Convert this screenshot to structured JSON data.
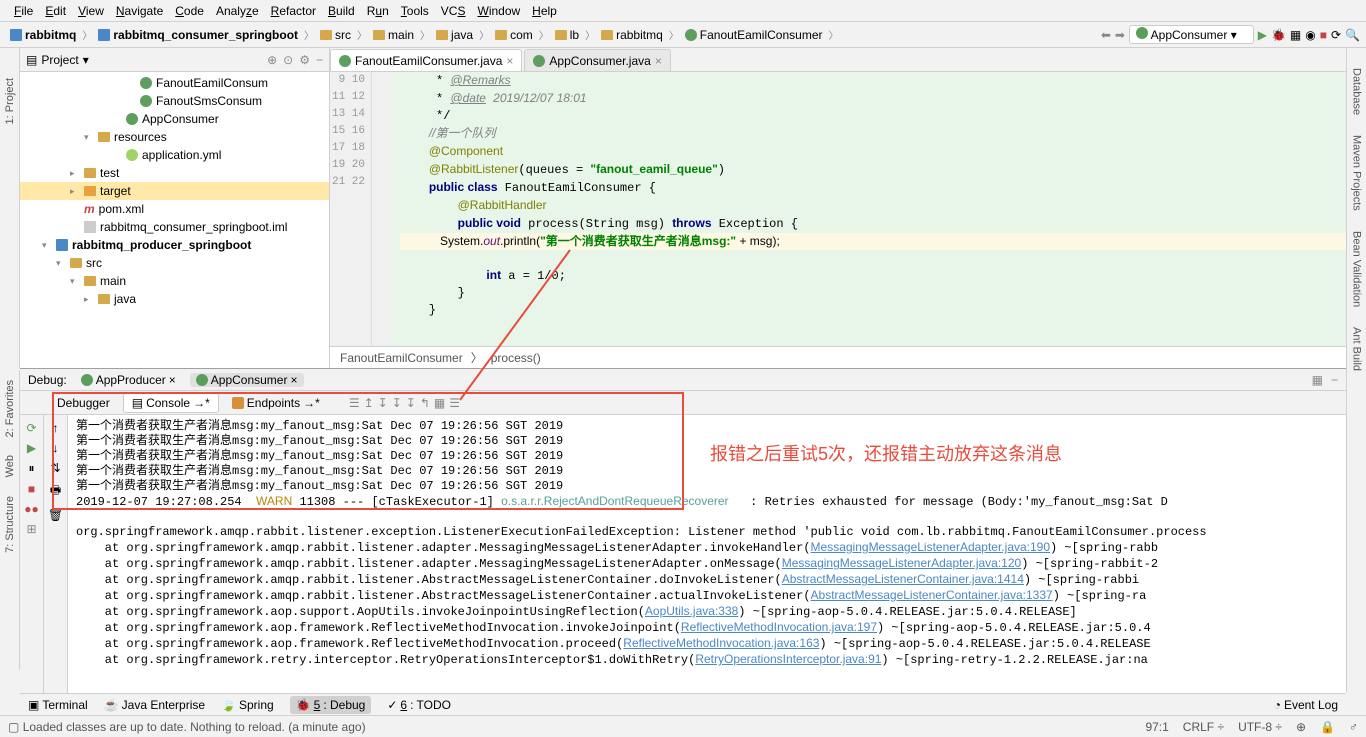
{
  "menubar": [
    "File",
    "Edit",
    "View",
    "Navigate",
    "Code",
    "Analyze",
    "Refactor",
    "Build",
    "Run",
    "Tools",
    "VCS",
    "Window",
    "Help"
  ],
  "breadcrumbs": [
    "rabbitmq",
    "rabbitmq_consumer_springboot",
    "src",
    "main",
    "java",
    "com",
    "lb",
    "rabbitmq",
    "FanoutEamilConsumer"
  ],
  "runConfig": "AppConsumer",
  "project": {
    "title": "Project",
    "tree": [
      {
        "indent": 7,
        "icon": "class",
        "name": "FanoutEamilConsum"
      },
      {
        "indent": 7,
        "icon": "class",
        "name": "FanoutSmsConsum"
      },
      {
        "indent": 6,
        "icon": "class-green",
        "name": "AppConsumer"
      },
      {
        "indent": 4,
        "arrow": "▾",
        "icon": "folder-res",
        "name": "resources"
      },
      {
        "indent": 6,
        "icon": "yml",
        "name": "application.yml"
      },
      {
        "indent": 3,
        "arrow": "▸",
        "icon": "folder",
        "name": "test"
      },
      {
        "indent": 3,
        "arrow": "▸",
        "icon": "folder-orange",
        "name": "target",
        "selected": true
      },
      {
        "indent": 3,
        "icon": "maven",
        "name": "pom.xml"
      },
      {
        "indent": 3,
        "icon": "file",
        "name": "rabbitmq_consumer_springboot.iml"
      },
      {
        "indent": 1,
        "arrow": "▾",
        "icon": "module",
        "name": "rabbitmq_producer_springboot",
        "bold": true
      },
      {
        "indent": 2,
        "arrow": "▾",
        "icon": "folder",
        "name": "src"
      },
      {
        "indent": 3,
        "arrow": "▾",
        "icon": "folder",
        "name": "main"
      },
      {
        "indent": 4,
        "arrow": "▸",
        "icon": "folder",
        "name": "java"
      }
    ]
  },
  "editorTabs": [
    {
      "name": "FanoutEamilConsumer.java",
      "active": true
    },
    {
      "name": "AppConsumer.java",
      "active": false
    }
  ],
  "code": {
    "startLine": 9,
    "lines": [
      {
        "n": 9,
        "html": "     * <span class='doctag'>@Remarks</span>"
      },
      {
        "n": 10,
        "html": "     * <span class='doctag'>@date</span> <span class='doc'>2019/12/07 18:01</span>"
      },
      {
        "n": 11,
        "html": "     */"
      },
      {
        "n": 12,
        "html": "    <span class='comment'>//第一个队列</span>"
      },
      {
        "n": 13,
        "html": "    <span class='anno'>@Component</span>"
      },
      {
        "n": 14,
        "html": "    <span class='anno'>@RabbitListener</span>(queues = <span class='str'>\"fanout_eamil_queue\"</span>)"
      },
      {
        "n": 15,
        "html": "    <span class='kw'>public class</span> FanoutEamilConsumer {"
      },
      {
        "n": 16,
        "html": "        <span class='anno'>@RabbitHandler</span>"
      },
      {
        "n": 17,
        "html": "        <span class='kw'>public void</span> process(String msg) <span class='kw'>throws</span> Exception {"
      },
      {
        "n": 18,
        "hl": true,
        "html": "            System.<span class='field'>out</span>.println(<span class='str'>\"第一个消费者获取生产者消息msg:\"</span> + msg);"
      },
      {
        "n": 19,
        "html": "            <span class='kw'>int</span> a = 1/0;"
      },
      {
        "n": 20,
        "html": "        }"
      },
      {
        "n": 21,
        "html": "    }"
      },
      {
        "n": 22,
        "html": ""
      }
    ]
  },
  "editorCrumbs": [
    "FanoutEamilConsumer",
    "process()"
  ],
  "debug": {
    "label": "Debug:",
    "tabs": [
      {
        "name": "AppProducer"
      },
      {
        "name": "AppConsumer",
        "active": true
      }
    ],
    "subtabs": [
      "Debugger",
      "Console",
      "Endpoints"
    ],
    "activeSubtab": "Console"
  },
  "console": {
    "repeated": "第一个消费者获取生产者消息msg:my_fanout_msg:Sat Dec 07 19:26:56 SGT 2019",
    "warnLine": {
      "ts": "2019-12-07 19:27:08.254",
      "level": "WARN",
      "pid": "11308",
      "thread": "[cTaskExecutor-1]",
      "logger": "o.s.a.r.r.RejectAndDontRequeueRecoverer",
      "msg": ": Retries exhausted for message (Body:'my_fanout_msg:Sat D"
    },
    "stack": [
      "org.springframework.amqp.rabbit.listener.exception.ListenerExecutionFailedException: Listener method 'public void com.lb.rabbitmq.FanoutEamilConsumer.process",
      "    at org.springframework.amqp.rabbit.listener.adapter.MessagingMessageListenerAdapter.invokeHandler(<link>MessagingMessageListenerAdapter.java:190</link>) ~[spring-rabb",
      "    at org.springframework.amqp.rabbit.listener.adapter.MessagingMessageListenerAdapter.onMessage(<link>MessagingMessageListenerAdapter.java:120</link>) ~[spring-rabbit-2",
      "    at org.springframework.amqp.rabbit.listener.AbstractMessageListenerContainer.doInvokeListener(<link>AbstractMessageListenerContainer.java:1414</link>) ~[spring-rabbi",
      "    at org.springframework.amqp.rabbit.listener.AbstractMessageListenerContainer.actualInvokeListener(<link>AbstractMessageListenerContainer.java:1337</link>) ~[spring-ra",
      "    at org.springframework.aop.support.AopUtils.invokeJoinpointUsingReflection(<link>AopUtils.java:338</link>) ~[spring-aop-5.0.4.RELEASE.jar:5.0.4.RELEASE]",
      "    at org.springframework.aop.framework.ReflectiveMethodInvocation.invokeJoinpoint(<link>ReflectiveMethodInvocation.java:197</link>) ~[spring-aop-5.0.4.RELEASE.jar:5.0.4",
      "    at org.springframework.aop.framework.ReflectiveMethodInvocation.proceed(<link>ReflectiveMethodInvocation.java:163</link>) ~[spring-aop-5.0.4.RELEASE.jar:5.0.4.RELEASE",
      "    at org.springframework.retry.interceptor.RetryOperationsInterceptor$1.doWithRetry(<link>RetryOperationsInterceptor.java:91</link>) ~[spring-retry-1.2.2.RELEASE.jar:na"
    ]
  },
  "annotation": "报错之后重试5次，还报错主动放弃这条消息",
  "bottomTools": [
    "Terminal",
    "Java Enterprise",
    "Spring",
    "5: Debug",
    "6: TODO"
  ],
  "bottomToolsActive": "5: Debug",
  "eventLog": "Event Log",
  "statusMessage": "Loaded classes are up to date. Nothing to reload. (a minute ago)",
  "statusRight": [
    "97:1",
    "CRLF ÷",
    "UTF-8 ÷",
    "⊕",
    "🔒",
    "♂"
  ],
  "leftStrip": [
    "1: Project"
  ],
  "leftStrip2": [
    "2: Favorites",
    "Web",
    "7: Structure"
  ],
  "rightStrip": [
    "Database",
    "Maven Projects",
    "Bean Validation",
    "Ant Build"
  ]
}
